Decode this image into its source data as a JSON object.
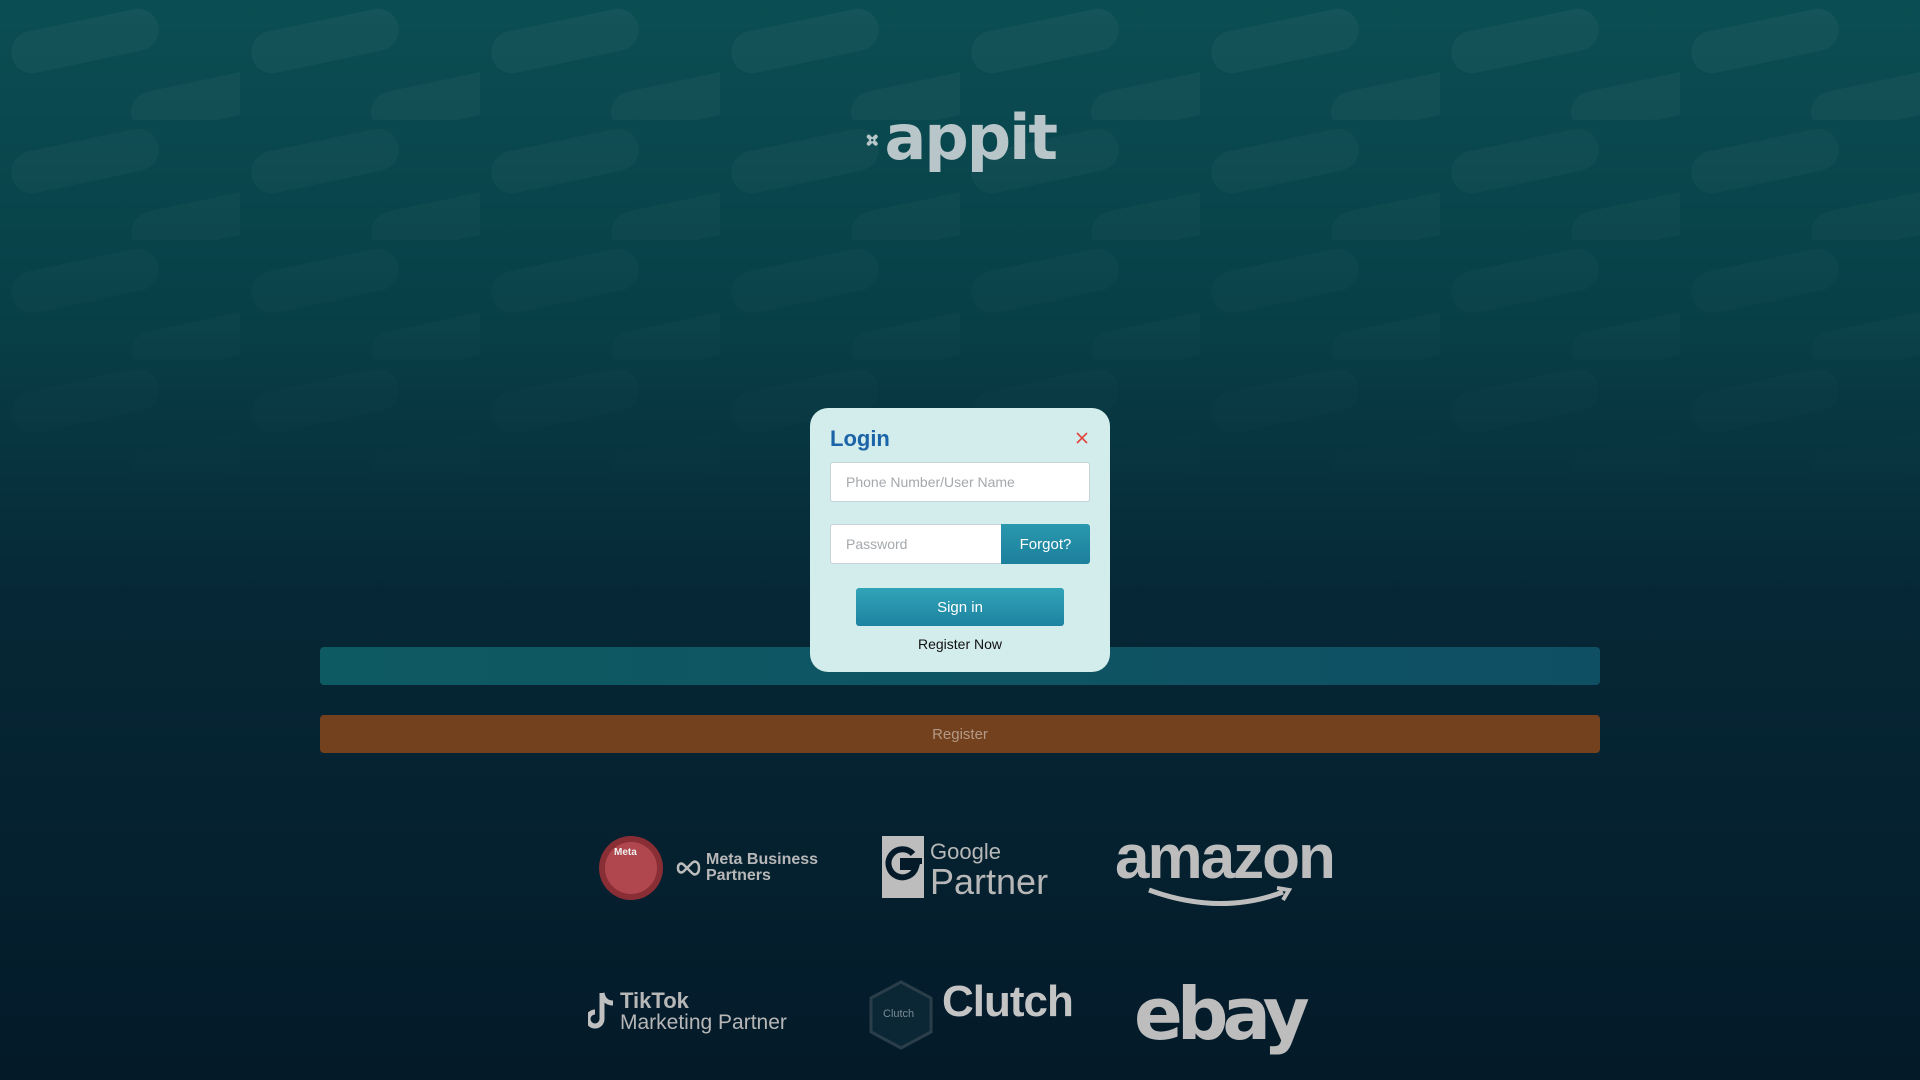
{
  "brand": {
    "name": "appit"
  },
  "page": {
    "login_bar_label": "",
    "register_bar_label": "Register"
  },
  "partners": [
    {
      "name": "Meta Business Partners",
      "line1": "Meta Business",
      "line2": "Partners",
      "badge": "Meta"
    },
    {
      "name": "Google Partner",
      "line1": "Google",
      "line2": "Partner"
    },
    {
      "name": "amazon",
      "line1": "amazon"
    },
    {
      "name": "TikTok Marketing Partner",
      "line1": "TikTok",
      "line2": "Marketing Partner"
    },
    {
      "name": "Clutch",
      "line1": "Clutch",
      "badge": "Clutch"
    },
    {
      "name": "ebay",
      "line1": "ebay"
    }
  ],
  "modal": {
    "title": "Login",
    "username_placeholder": "Phone Number/User Name",
    "password_placeholder": "Password",
    "forgot_label": "Forgot?",
    "signin_label": "Sign in",
    "register_link": "Register Now"
  },
  "colors": {
    "accent": "#1d83a0",
    "title": "#1b64a8",
    "register_bar": "#73411d",
    "close": "#e0463f"
  }
}
